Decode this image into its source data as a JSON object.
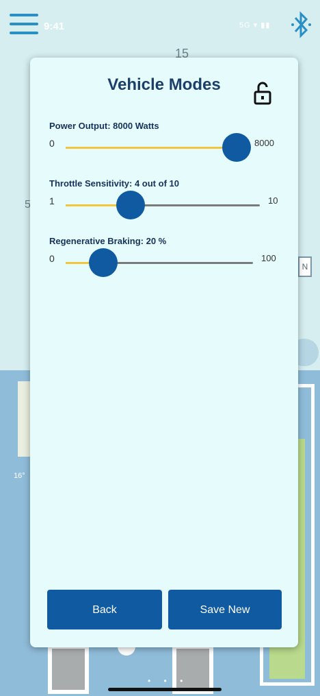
{
  "status": {
    "time": "9:41",
    "icons": "5G ▾ ▮▮"
  },
  "background": {
    "top_number": "15",
    "side_left": "5",
    "box_letter": "N",
    "left_label": "16°"
  },
  "modal": {
    "title": "Vehicle Modes",
    "sliders": [
      {
        "label": "Power Output: 8000 Watts",
        "min": "0",
        "max": "8000",
        "value": 8000,
        "range": [
          0,
          8000
        ]
      },
      {
        "label": "Throttle Sensitivity: 4 out of 10",
        "min": "1",
        "max": "10",
        "value": 4,
        "range": [
          1,
          10
        ]
      },
      {
        "label": "Regenerative Braking: 20 %",
        "min": "0",
        "max": "100",
        "value": 20,
        "range": [
          0,
          100
        ]
      }
    ],
    "back_label": "Back",
    "save_label": "Save New"
  },
  "colors": {
    "accent": "#0f5aa0",
    "fill": "#f2c53a",
    "title": "#1b3f6a",
    "modal_bg": "#e6fbfb"
  }
}
